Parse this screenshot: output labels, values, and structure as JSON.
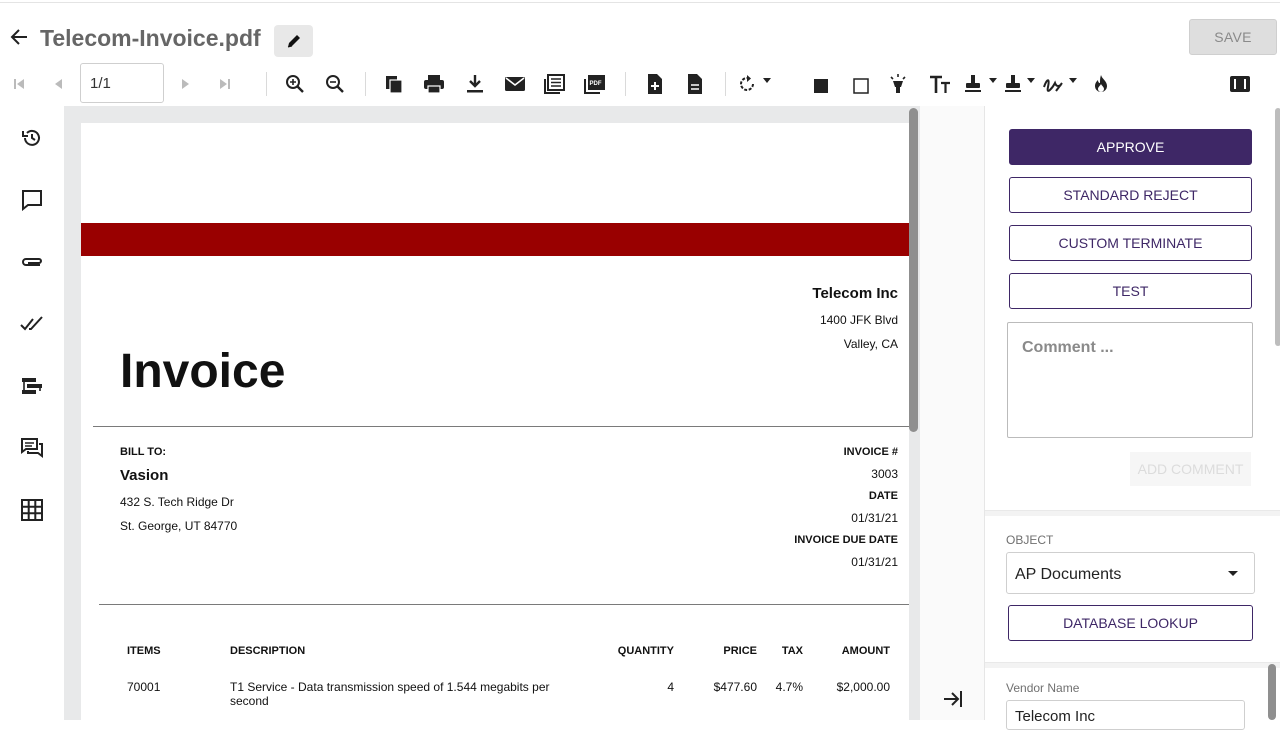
{
  "header": {
    "title": "Telecom-Invoice.pdf",
    "save_label": "SAVE"
  },
  "toolbar": {
    "page_value": "1/1",
    "icons": [
      "first-page-icon",
      "prev-page-icon",
      "next-page-icon",
      "last-page-icon",
      "zoom-in-icon",
      "zoom-out-icon",
      "copy-icon",
      "print-icon",
      "download-icon",
      "email-icon",
      "pages-icon",
      "pdf-icon",
      "add-file-icon",
      "document-icon",
      "rotate-icon",
      "filled-rect-icon",
      "outline-rect-icon",
      "highlighter-icon",
      "text-icon",
      "stamp-icon",
      "stamp-menu-icon",
      "signature-icon",
      "burn-icon",
      "panel-toggle-icon"
    ]
  },
  "leftbar": {
    "icons": [
      "history-icon",
      "comment-icon",
      "attachment-icon",
      "approve-check-icon",
      "workflow-icon",
      "chat-icon",
      "grid-icon"
    ]
  },
  "document": {
    "company_name": "Telecom Inc",
    "company_addr1": "1400 JFK Blvd",
    "company_addr2": "Valley, CA",
    "title": "Invoice",
    "bill_to_label": "BILL TO:",
    "bill_to_name": "Vasion",
    "bill_to_addr1": "432 S. Tech Ridge Dr",
    "bill_to_addr2": "St. George, UT 84770",
    "invoice_no_label": "INVOICE #",
    "invoice_no": "3003",
    "date_label": "DATE",
    "date": "01/31/21",
    "due_label": "INVOICE DUE DATE",
    "due": "01/31/21",
    "table_headers": {
      "items": "ITEMS",
      "description": "DESCRIPTION",
      "quantity": "QUANTITY",
      "price": "PRICE",
      "tax": "TAX",
      "amount": "AMOUNT"
    },
    "rows": [
      {
        "item": "70001",
        "desc1": "T1 Service - Data transmission speed of 1.544 megabits per",
        "desc2": "second",
        "qty": "4",
        "price": "$477.60",
        "tax": "4.7%",
        "amount": "$2,000.00"
      }
    ]
  },
  "panel": {
    "approve": "APPROVE",
    "standard_reject": "STANDARD REJECT",
    "custom_terminate": "CUSTOM TERMINATE",
    "test": "TEST",
    "comment_placeholder": "Comment ...",
    "add_comment": "ADD COMMENT",
    "object_label": "OBJECT",
    "object_value": "AP Documents",
    "database_lookup": "DATABASE LOOKUP",
    "vendor_label": "Vendor Name",
    "vendor_value": "Telecom Inc"
  },
  "colors": {
    "accent": "#3e2766",
    "band": "#990000"
  }
}
